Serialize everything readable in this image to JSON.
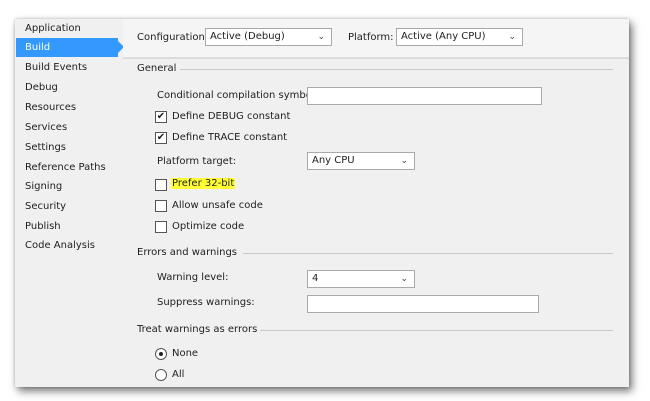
{
  "sidebar": {
    "items": [
      "Application",
      "Build",
      "Build Events",
      "Debug",
      "Resources",
      "Services",
      "Settings",
      "Reference Paths",
      "Signing",
      "Security",
      "Publish",
      "Code Analysis"
    ],
    "active": "Build"
  },
  "topbar": {
    "configuration_label": "Configuration:",
    "configuration_value": "Active (Debug)",
    "platform_label": "Platform:",
    "platform_value": "Active (Any CPU)"
  },
  "general": {
    "heading": "General",
    "cond_label": "Conditional compilation symbols:",
    "cond_value": "",
    "define_debug": "Define DEBUG constant",
    "define_trace": "Define TRACE constant",
    "platform_target_label": "Platform target:",
    "platform_target_value": "Any CPU",
    "prefer32": "Prefer 32-bit",
    "unsafe": "Allow unsafe code",
    "optimize": "Optimize code"
  },
  "errors": {
    "heading": "Errors and warnings",
    "warning_level_label": "Warning level:",
    "warning_level_value": "4",
    "suppress_label": "Suppress warnings:",
    "suppress_value": ""
  },
  "treat": {
    "heading": "Treat warnings as errors",
    "none": "None",
    "all": "All"
  },
  "colors": {
    "accent": "#3399ff",
    "highlight": "#ffff33"
  }
}
